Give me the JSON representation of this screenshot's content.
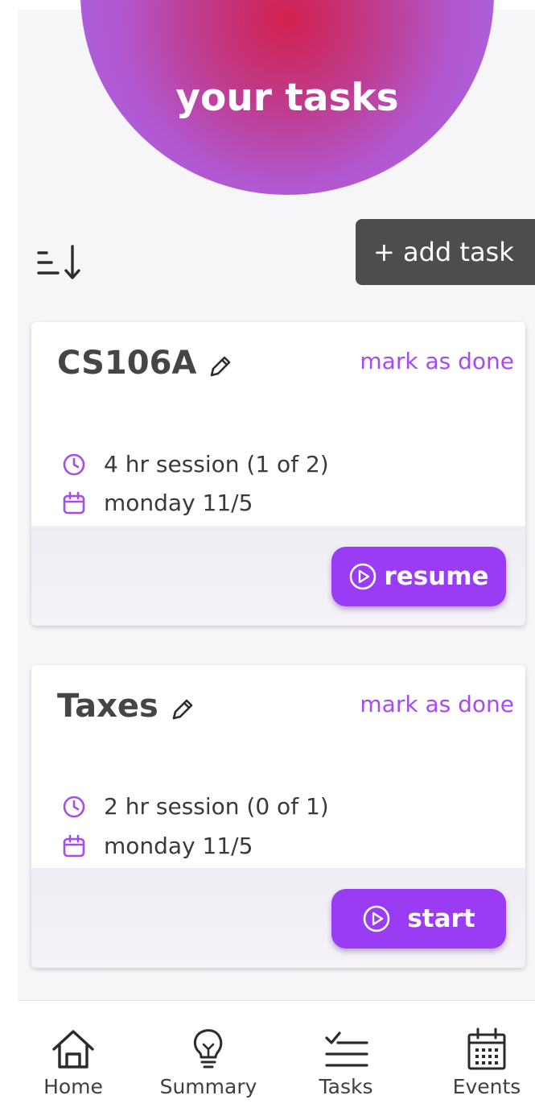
{
  "header": {
    "title": "your tasks"
  },
  "toolbar": {
    "sort_icon": "sort-descending-icon",
    "add_task_label": "+ add task"
  },
  "tasks": [
    {
      "title": "CS106A",
      "mark_done_label": "mark as done",
      "session_text": "4 hr session (1 of 2)",
      "date_text": "monday 11/5",
      "action_label": "resume"
    },
    {
      "title": "Taxes",
      "mark_done_label": "mark as done",
      "session_text": "2 hr session (0 of 1)",
      "date_text": "monday 11/5",
      "action_label": "start"
    }
  ],
  "nav": {
    "items": [
      {
        "label": "Home",
        "icon": "home-icon"
      },
      {
        "label": "Summary",
        "icon": "lightbulb-icon"
      },
      {
        "label": "Tasks",
        "icon": "checklist-icon"
      },
      {
        "label": "Events",
        "icon": "calendar-icon"
      }
    ]
  },
  "colors": {
    "accent": "#9b3cf5",
    "accent_text": "#a64bf4",
    "header_gradient_center": "#d2214f",
    "header_gradient_edge": "#a56ff2",
    "add_task_bg": "#4d4d4d"
  }
}
